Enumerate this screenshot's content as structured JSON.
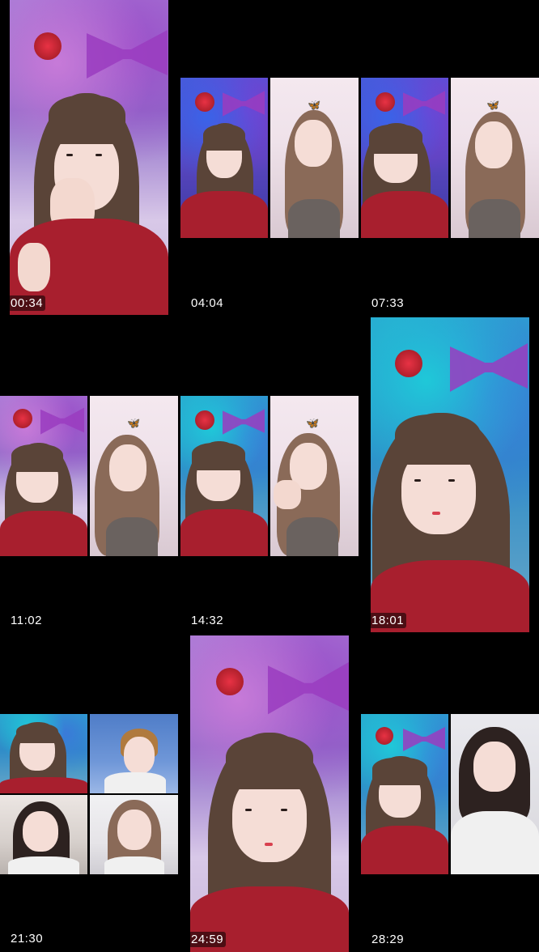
{
  "grid": {
    "thumbnails": [
      {
        "timestamp": "00:34"
      },
      {
        "timestamp": "04:04"
      },
      {
        "timestamp": "07:33"
      },
      {
        "timestamp": "11:02"
      },
      {
        "timestamp": "14:32"
      },
      {
        "timestamp": "18:01"
      },
      {
        "timestamp": "21:30"
      },
      {
        "timestamp": "24:59"
      },
      {
        "timestamp": "28:29"
      }
    ]
  },
  "colors": {
    "background": "#000000",
    "timestamp_text": "#ffffff",
    "top_red": "#a81f2e",
    "bg_purple": "#a77bd6",
    "bg_teal": "#2aa6d0"
  },
  "icons": [
    "butterfly-icon",
    "lantern-decoration",
    "bow-decoration"
  ]
}
